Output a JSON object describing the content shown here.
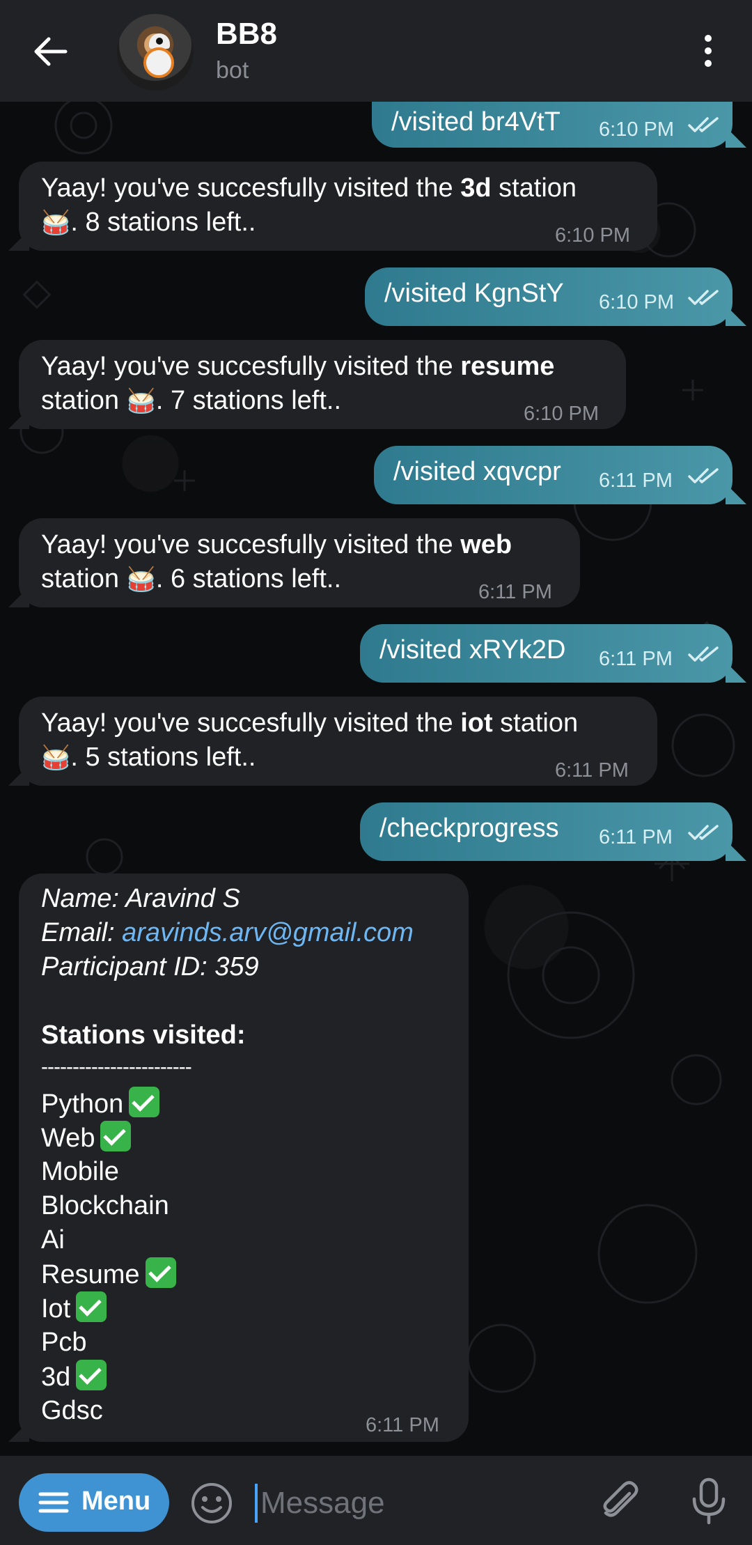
{
  "header": {
    "title": "BB8",
    "subtitle": "bot"
  },
  "messages": [
    {
      "type": "out",
      "text": "/visited br4VtT",
      "time": "6:10 PM"
    },
    {
      "type": "in",
      "pre": "Yaay! you've succesfully visited the ",
      "bold": "3d",
      "post": " station",
      "line2": ". 8 stations left..",
      "time": "6:10 PM"
    },
    {
      "type": "out",
      "text": "/visited KgnStY",
      "time": "6:10 PM"
    },
    {
      "type": "in",
      "pre": "Yaay! you've succesfully visited the ",
      "bold": "resume",
      "post": "",
      "line2": "station",
      "line2b": ". 7 stations left..",
      "time": "6:10 PM"
    },
    {
      "type": "out",
      "text": "/visited xqvcpr",
      "time": "6:11 PM"
    },
    {
      "type": "in",
      "pre": "Yaay! you've succesfully visited the ",
      "bold": "web",
      "post": "",
      "line2": "station",
      "line2b": ". 6 stations left..",
      "time": "6:11 PM"
    },
    {
      "type": "out",
      "text": "/visited xRYk2D",
      "time": "6:11 PM"
    },
    {
      "type": "in",
      "pre": "Yaay! you've succesfully visited the ",
      "bold": "iot",
      "post": " station",
      "line2": ". 5 stations left..",
      "time": "6:11 PM"
    },
    {
      "type": "out",
      "text": "/checkprogress",
      "time": "6:11 PM"
    }
  ],
  "progress": {
    "name_line": "Name: Aravind S",
    "email_label": "Email: ",
    "email": "aravinds.arv@gmail.com",
    "participant_line": "Participant ID: 359",
    "stations_heading": "Stations visited:",
    "divider": "------------------------",
    "stations": [
      {
        "name": "Python",
        "visited": true
      },
      {
        "name": "Web",
        "visited": true
      },
      {
        "name": "Mobile",
        "visited": false
      },
      {
        "name": "Blockchain",
        "visited": false
      },
      {
        "name": "Ai",
        "visited": false
      },
      {
        "name": "Resume",
        "visited": true
      },
      {
        "name": "Iot",
        "visited": true
      },
      {
        "name": "Pcb",
        "visited": false
      },
      {
        "name": "3d",
        "visited": true
      },
      {
        "name": "Gdsc",
        "visited": false
      }
    ],
    "time": "6:11 PM"
  },
  "inputbar": {
    "menu_label": "Menu",
    "placeholder": "Message"
  },
  "icons": {
    "back": "arrow-left-icon",
    "more": "more-vertical-icon",
    "menu": "menu-lines-icon",
    "emoji": "emoji-icon",
    "attach": "paperclip-icon",
    "mic": "microphone-icon",
    "read": "double-check-icon",
    "drum": "drum-emoji"
  },
  "colors": {
    "header_bg": "#212226",
    "incoming_bubble": "#212226",
    "outgoing_bubble": "#3a8a9d",
    "menu_button": "#3f93d2",
    "link": "#6fb7f2",
    "check_green": "#38b34a"
  }
}
